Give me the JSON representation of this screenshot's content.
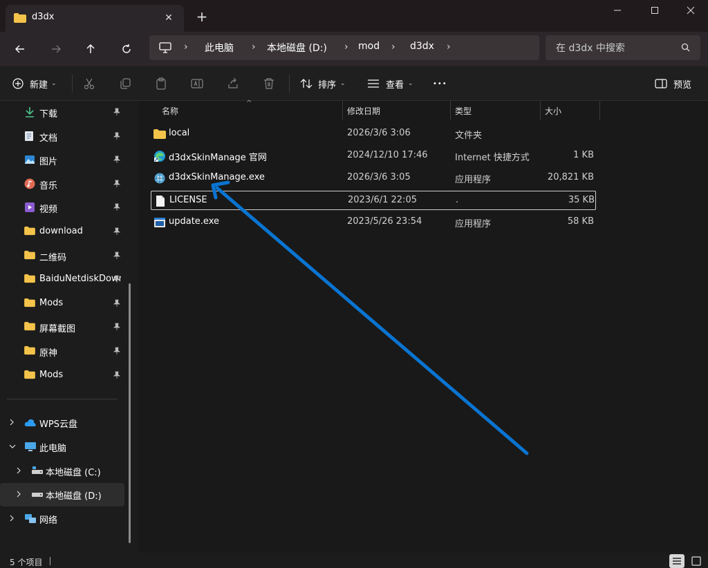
{
  "window": {
    "tab_title": "d3dx",
    "new_tab": "+"
  },
  "nav": {
    "breadcrumbs": [
      "此电脑",
      "本地磁盘 (D:)",
      "mod",
      "d3dx"
    ],
    "search_placeholder": "在 d3dx 中搜索"
  },
  "toolbar": {
    "new_label": "新建",
    "sort_label": "排序",
    "view_label": "查看",
    "more_label": "•••",
    "preview_label": "预览"
  },
  "sidebar": {
    "quick_access": [
      {
        "label": "下载",
        "icon": "download-icon"
      },
      {
        "label": "文档",
        "icon": "document-icon"
      },
      {
        "label": "图片",
        "icon": "picture-icon"
      },
      {
        "label": "音乐",
        "icon": "music-icon"
      },
      {
        "label": "视频",
        "icon": "video-icon"
      },
      {
        "label": "download",
        "icon": "folder-icon"
      },
      {
        "label": "二维码",
        "icon": "folder-icon"
      },
      {
        "label": "BaiduNetdiskDownload",
        "icon": "folder-icon"
      },
      {
        "label": "Mods",
        "icon": "folder-icon"
      },
      {
        "label": "屏幕截图",
        "icon": "folder-icon"
      },
      {
        "label": "原神",
        "icon": "folder-icon"
      },
      {
        "label": "Mods",
        "icon": "folder-icon"
      }
    ],
    "tree": [
      {
        "label": "WPS云盘",
        "icon": "cloud-icon"
      },
      {
        "label": "此电脑",
        "icon": "pc-icon"
      },
      {
        "label": "本地磁盘 (C:)",
        "icon": "drive-icon"
      },
      {
        "label": "本地磁盘 (D:)",
        "icon": "drive-icon"
      },
      {
        "label": "网络",
        "icon": "network-icon"
      }
    ]
  },
  "file_list": {
    "columns": [
      "名称",
      "修改日期",
      "类型",
      "大小"
    ],
    "rows": [
      {
        "name": "local",
        "date": "2026/3/6 3:06",
        "type": "文件夹",
        "size": "",
        "icon": "folder-icon"
      },
      {
        "name": "d3dxSkinManage 官网",
        "date": "2024/12/10 17:46",
        "type": "Internet 快捷方式",
        "size": "1 KB",
        "icon": "edge-shortcut-icon"
      },
      {
        "name": "d3dxSkinManage.exe",
        "date": "2026/3/6 3:05",
        "type": "应用程序",
        "size": "20,821 KB",
        "icon": "exe-icon"
      },
      {
        "name": "LICENSE",
        "date": "2023/6/1 22:05",
        "type": ".",
        "size": "35 KB",
        "icon": "file-icon"
      },
      {
        "name": "update.exe",
        "date": "2023/5/26 23:54",
        "type": "应用程序",
        "size": "58 KB",
        "icon": "app-window-icon"
      }
    ]
  },
  "status": {
    "item_count": "5 个项目"
  },
  "colors": {
    "accent_arrow": "#0a74d1",
    "folder": "#f4c34a"
  }
}
